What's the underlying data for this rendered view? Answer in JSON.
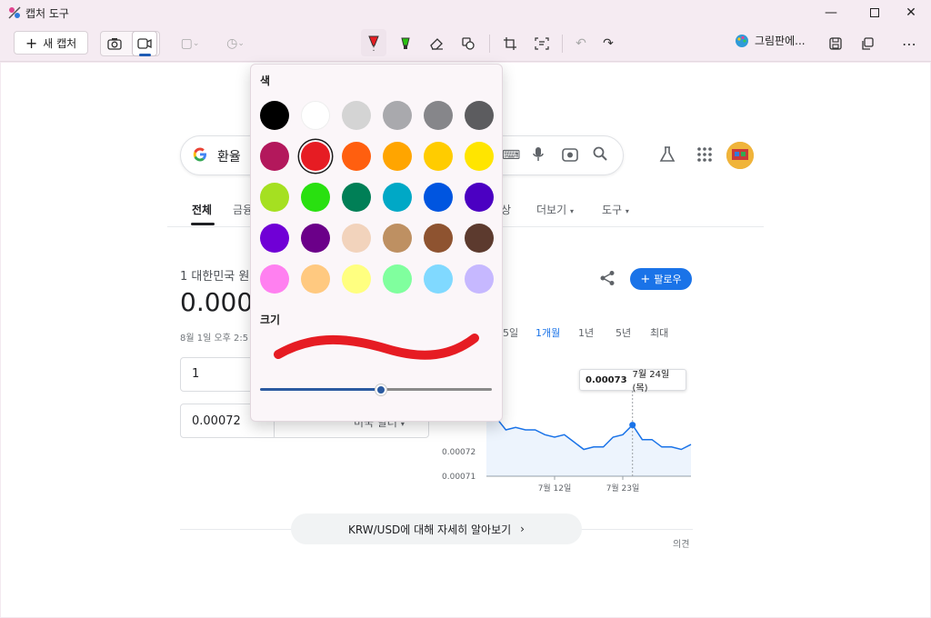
{
  "window": {
    "title": "캡처 도구"
  },
  "toolbar": {
    "new_capture_label": "새 캡처",
    "paint_label": "그림판에...",
    "more_label": "⋯"
  },
  "google": {
    "search_value": "환율",
    "tabs": [
      "전체",
      "금융",
      "영상",
      "더보기",
      "도구"
    ],
    "conversion_label": "1 대한민국 원",
    "big_value": "0.000",
    "date_line": "8월 1일 오후 2:5",
    "input_amount": "1",
    "output_amount": "0.00072",
    "output_currency": "미국 달러",
    "ranges": [
      "5일",
      "1개월",
      "1년",
      "5년",
      "최대"
    ],
    "active_range": "1개월",
    "follow_label": "팔로우",
    "more_info": "KRW/USD에 대해 자세히 알아보기",
    "feedback": "의견"
  },
  "chart_data": {
    "type": "line",
    "title": "",
    "xlabel": "",
    "ylabel": "",
    "x_tick_labels": [
      "7월 12일",
      "7월 23일"
    ],
    "y_tick_labels": [
      "0.00072",
      "0.00071"
    ],
    "tooltip": {
      "value": "0.00073",
      "date": "7월 24일 (목)"
    },
    "series": [
      {
        "values": [
          0.000734,
          0.000734,
          0.000729,
          0.00073,
          0.000729,
          0.000729,
          0.000727,
          0.000726,
          0.000727,
          0.000724,
          0.000721,
          0.000722,
          0.000722,
          0.000726,
          0.000727,
          0.000731,
          0.000725,
          0.000725,
          0.000722,
          0.000722,
          0.000721,
          0.000723
        ]
      }
    ],
    "highlight_index": 15,
    "accent_color": "#1a73e8"
  },
  "popup": {
    "color_heading": "색",
    "size_heading": "크기",
    "colors": [
      "#000000",
      "#ffffff",
      "#d4d4d4",
      "#a9a9ad",
      "#86868a",
      "#5c5c5f",
      "#b3185c",
      "#e61c23",
      "#ff5f0f",
      "#ffa500",
      "#ffcc00",
      "#ffe500",
      "#a5e021",
      "#29e010",
      "#007f56",
      "#00a8c6",
      "#0055e0",
      "#4b00c2",
      "#7000d6",
      "#6b0089",
      "#f2d3bc",
      "#be9062",
      "#8e5330",
      "#5c3a2e",
      "#ff80f0",
      "#ffc980",
      "#ffff80",
      "#80ff9e",
      "#80d9ff",
      "#c6b8ff"
    ],
    "selected_color": "#e61c23",
    "pen_size_fraction": 0.52
  }
}
